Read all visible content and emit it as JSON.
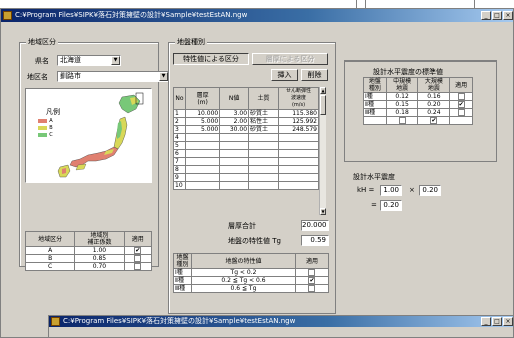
{
  "window": {
    "title": "C:¥Program Files¥SIPK¥落石対策擁壁の設計¥Sample¥testEstAN.ngw",
    "minimize": "_",
    "maximize": "□",
    "close": "×"
  },
  "region_group": {
    "title": "地域区分",
    "prefecture_label": "県名",
    "prefecture_value": "北海道",
    "place_label": "地区名",
    "place_value": "釧路市",
    "legend_title": "凡例",
    "legend_items": [
      {
        "label": "A",
        "color": "#e08070"
      },
      {
        "label": "B",
        "color": "#d8d858"
      },
      {
        "label": "C",
        "color": "#78c878"
      }
    ],
    "table": {
      "headers": [
        "地域区分",
        "地域別\n補正係数",
        "適用"
      ],
      "rows": [
        {
          "zone": "A",
          "coef": "1.00",
          "applied": true
        },
        {
          "zone": "B",
          "coef": "0.85",
          "applied": false
        },
        {
          "zone": "C",
          "coef": "0.70",
          "applied": false
        }
      ]
    }
  },
  "ground_group": {
    "title": "地盤種別",
    "tab_characteristic": "特性値による区分",
    "tab_layer": "層厚による区分",
    "insert_button": "挿入",
    "delete_button": "削除",
    "headers": [
      "No",
      "層厚\n(m)",
      "N値",
      "土質",
      "せん断弾性\n波速度\n(m/s)"
    ],
    "rows": [
      {
        "no": "1",
        "thickness": "10.000",
        "n": "3.00",
        "soil": "砂質土",
        "velocity": "115.380"
      },
      {
        "no": "2",
        "thickness": "5.000",
        "n": "2.00",
        "soil": "粘性土",
        "velocity": "125.992"
      },
      {
        "no": "3",
        "thickness": "5.000",
        "n": "30.00",
        "soil": "砂質土",
        "velocity": "248.579"
      },
      {
        "no": "4",
        "thickness": "",
        "n": "",
        "soil": "",
        "velocity": ""
      },
      {
        "no": "5",
        "thickness": "",
        "n": "",
        "soil": "",
        "velocity": ""
      },
      {
        "no": "6",
        "thickness": "",
        "n": "",
        "soil": "",
        "velocity": ""
      },
      {
        "no": "7",
        "thickness": "",
        "n": "",
        "soil": "",
        "velocity": ""
      },
      {
        "no": "8",
        "thickness": "",
        "n": "",
        "soil": "",
        "velocity": ""
      },
      {
        "no": "9",
        "thickness": "",
        "n": "",
        "soil": "",
        "velocity": ""
      },
      {
        "no": "10",
        "thickness": "",
        "n": "",
        "soil": "",
        "velocity": ""
      }
    ],
    "total_label": "層厚合計",
    "total_value": "20.000",
    "period_label": "地盤の特性値 Tg",
    "period_value": "0.59",
    "class_headers": [
      "地盤\n種別",
      "地盤の特性値",
      "適用"
    ],
    "class_rows": [
      {
        "type": "Ⅰ種",
        "range": "Tg < 0.2",
        "applied": false
      },
      {
        "type": "Ⅱ種",
        "range": "0.2 ≦ Tg < 0.6",
        "applied": true
      },
      {
        "type": "Ⅲ種",
        "range": "0.6 ≦ Tg",
        "applied": false
      }
    ]
  },
  "seismic_group": {
    "title": "設計水平震度の標準値",
    "headers": [
      "地盤\n種別",
      "中規模\n地震",
      "大規模\n地震",
      "適用"
    ],
    "rows": [
      {
        "type": "Ⅰ種",
        "mid": "0.12",
        "large": "0.16",
        "applied": false
      },
      {
        "type": "Ⅱ種",
        "mid": "0.15",
        "large": "0.20",
        "applied": true
      },
      {
        "type": "Ⅲ種",
        "mid": "0.18",
        "large": "0.24",
        "applied": false
      }
    ],
    "footer_mid_checked": false,
    "footer_large_checked": true,
    "design_label": "設計水平震度",
    "kh_label": "kH =",
    "factor_value": "1.00",
    "times": "×",
    "base_value": "0.20",
    "equals": "=",
    "result_value": "0.20"
  },
  "second_window": {
    "title": "C:¥Program Files¥SIPK¥落石対策擁壁の設計¥Sample¥testEstAN.ngw"
  }
}
